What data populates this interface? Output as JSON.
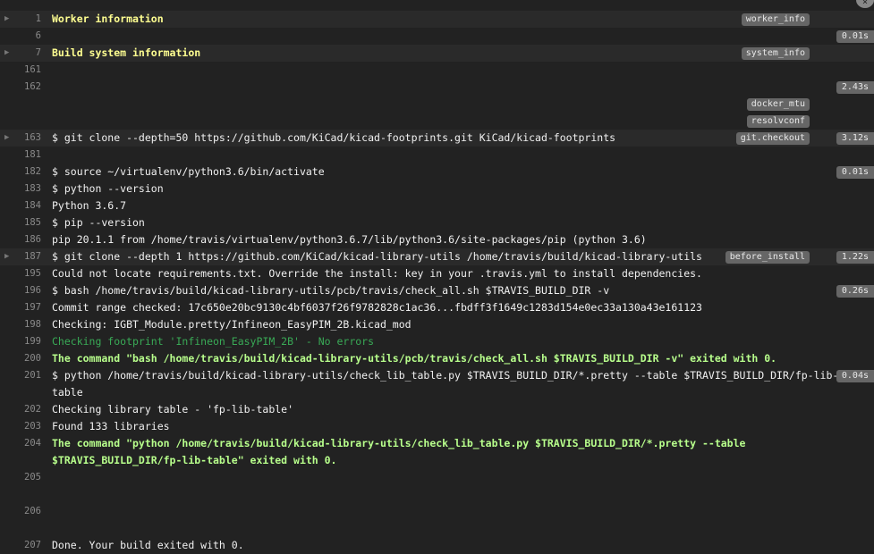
{
  "corner_icon": "close-icon",
  "lines": [
    {
      "num": "1",
      "text": "Worker information",
      "style": "yellow",
      "fold": true,
      "tag": "worker_info",
      "time": ""
    },
    {
      "num": "6",
      "text": "",
      "style": "",
      "fold": false,
      "tag": "",
      "time": "0.01s"
    },
    {
      "num": "7",
      "text": "Build system information",
      "style": "yellow",
      "fold": true,
      "tag": "system_info",
      "time": ""
    },
    {
      "num": "161",
      "text": "",
      "style": "",
      "fold": false,
      "tag": "",
      "time": ""
    },
    {
      "num": "162",
      "text": "",
      "style": "",
      "fold": false,
      "tag": "",
      "time": "2.43s"
    },
    {
      "num": "",
      "text": "",
      "style": "",
      "fold": false,
      "tag": "docker_mtu",
      "time": ""
    },
    {
      "num": "",
      "text": "",
      "style": "",
      "fold": false,
      "tag": "resolvconf",
      "time": ""
    },
    {
      "num": "163",
      "text": "$ git clone --depth=50 https://github.com/KiCad/kicad-footprints.git KiCad/kicad-footprints",
      "style": "",
      "fold": true,
      "tag": "git.checkout",
      "time": "3.12s"
    },
    {
      "num": "181",
      "text": "",
      "style": "",
      "fold": false,
      "tag": "",
      "time": ""
    },
    {
      "num": "182",
      "text": "$ source ~/virtualenv/python3.6/bin/activate",
      "style": "",
      "fold": false,
      "tag": "",
      "time": "0.01s"
    },
    {
      "num": "183",
      "text": "$ python --version",
      "style": "",
      "fold": false,
      "tag": "",
      "time": ""
    },
    {
      "num": "184",
      "text": "Python 3.6.7",
      "style": "",
      "fold": false,
      "tag": "",
      "time": ""
    },
    {
      "num": "185",
      "text": "$ pip --version",
      "style": "",
      "fold": false,
      "tag": "",
      "time": ""
    },
    {
      "num": "186",
      "text": "pip 20.1.1 from /home/travis/virtualenv/python3.6.7/lib/python3.6/site-packages/pip (python 3.6)",
      "style": "",
      "fold": false,
      "tag": "",
      "time": ""
    },
    {
      "num": "187",
      "text": "$ git clone --depth 1 https://github.com/KiCad/kicad-library-utils /home/travis/build/kicad-library-utils",
      "style": "",
      "fold": true,
      "tag": "before_install",
      "time": "1.22s"
    },
    {
      "num": "195",
      "text": "Could not locate requirements.txt. Override the install: key in your .travis.yml to install dependencies.",
      "style": "",
      "fold": false,
      "tag": "",
      "time": ""
    },
    {
      "num": "196",
      "text": "$ bash /home/travis/build/kicad-library-utils/pcb/travis/check_all.sh $TRAVIS_BUILD_DIR -v",
      "style": "",
      "fold": false,
      "tag": "",
      "time": "0.26s"
    },
    {
      "num": "197",
      "text": "Commit range checked: 17c650e20bc9130c4bf6037f26f9782828c1ac36...fbdff3f1649c1283d154e0ec33a130a43e161123",
      "style": "",
      "fold": false,
      "tag": "",
      "time": ""
    },
    {
      "num": "198",
      "text": "Checking: IGBT_Module.pretty/Infineon_EasyPIM_2B.kicad_mod",
      "style": "",
      "fold": false,
      "tag": "",
      "time": ""
    },
    {
      "num": "199",
      "text": "Checking footprint 'Infineon_EasyPIM_2B' - No errors",
      "style": "green",
      "fold": false,
      "tag": "",
      "time": ""
    },
    {
      "num": "200",
      "text": "The command \"bash /home/travis/build/kicad-library-utils/pcb/travis/check_all.sh $TRAVIS_BUILD_DIR -v\" exited with 0.",
      "style": "lgreen",
      "fold": false,
      "tag": "",
      "time": ""
    },
    {
      "num": "201",
      "text": "$ python /home/travis/build/kicad-library-utils/check_lib_table.py $TRAVIS_BUILD_DIR/*.pretty --table $TRAVIS_BUILD_DIR/fp-lib-",
      "style": "",
      "fold": false,
      "tag": "",
      "time": "0.04s"
    },
    {
      "num": "",
      "text": "table",
      "style": "",
      "fold": false,
      "tag": "",
      "time": ""
    },
    {
      "num": "202",
      "text": "Checking library table - 'fp-lib-table'",
      "style": "",
      "fold": false,
      "tag": "",
      "time": ""
    },
    {
      "num": "203",
      "text": "Found 133 libraries",
      "style": "",
      "fold": false,
      "tag": "",
      "time": ""
    },
    {
      "num": "204",
      "text": "The command \"python /home/travis/build/kicad-library-utils/check_lib_table.py $TRAVIS_BUILD_DIR/*.pretty --table",
      "style": "lgreen",
      "fold": false,
      "tag": "",
      "time": ""
    },
    {
      "num": "",
      "text": "$TRAVIS_BUILD_DIR/fp-lib-table\" exited with 0.",
      "style": "lgreen",
      "fold": false,
      "tag": "",
      "time": ""
    },
    {
      "num": "205",
      "text": "",
      "style": "",
      "fold": false,
      "tag": "",
      "time": ""
    },
    {
      "num": "",
      "text": "",
      "style": "",
      "fold": false,
      "tag": "",
      "time": ""
    },
    {
      "num": "206",
      "text": "",
      "style": "",
      "fold": false,
      "tag": "",
      "time": ""
    },
    {
      "num": "",
      "text": "",
      "style": "",
      "fold": false,
      "tag": "",
      "time": ""
    },
    {
      "num": "207",
      "text": "Done. Your build exited with 0.",
      "style": "",
      "fold": false,
      "tag": "",
      "time": ""
    }
  ]
}
